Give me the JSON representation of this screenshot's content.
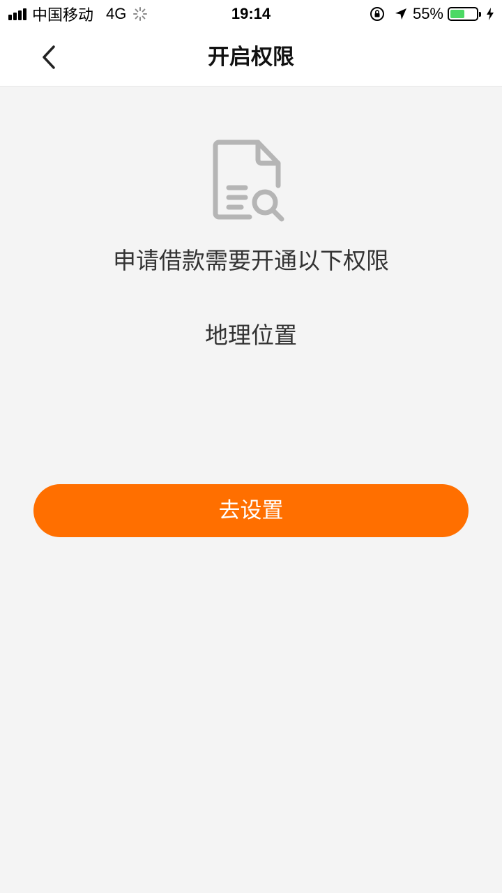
{
  "status_bar": {
    "carrier": "中国移动",
    "network": "4G",
    "time": "19:14",
    "battery_percent": "55%",
    "battery_level": 0.55,
    "battery_color": "#4cd964",
    "icons": [
      "signal-icon",
      "loading-spinner-icon",
      "rotation-lock-icon",
      "location-arrow-icon",
      "battery-icon",
      "charging-bolt-icon"
    ]
  },
  "navbar": {
    "title": "开启权限",
    "back_icon": "chevron-left-icon"
  },
  "content": {
    "icon": "document-search-icon",
    "headline": "申请借款需要开通以下权限",
    "permission": "地理位置"
  },
  "cta": {
    "label": "去设置",
    "color": "#ff6f00"
  }
}
